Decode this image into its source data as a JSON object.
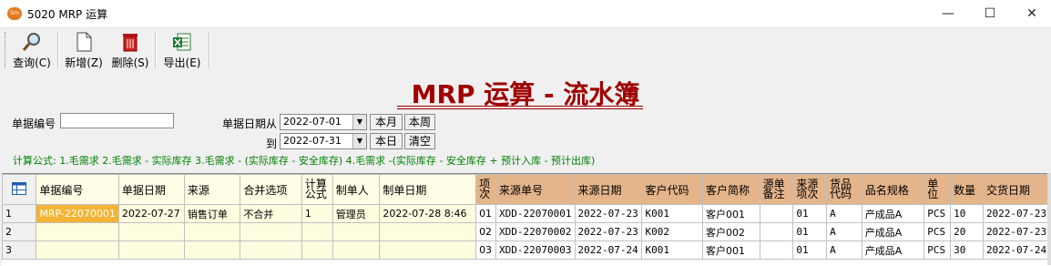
{
  "window": {
    "title": "5020 MRP 运算",
    "app_icon_text": "Sm",
    "minimize": "—",
    "maximize": "☐",
    "close": "✕"
  },
  "toolbar": {
    "query_label": "查询(C)",
    "new_label": "新增(Z)",
    "delete_label": "删除(S)",
    "export_label": "导出(E)"
  },
  "page_title": "MRP 运算 - 流水簿",
  "filters": {
    "doc_no_label": "单据编号",
    "doc_no_value": "",
    "date_from_label": "单据日期从",
    "date_from_value": "2022-07-01",
    "date_to_label": "到",
    "date_to_value": "2022-07-31",
    "this_month": "本月",
    "this_week": "本周",
    "today": "本日",
    "clear": "清空"
  },
  "formula": "计算公式: 1.毛需求  2.毛需求 - 实际库存  3.毛需求 - (实际库存 - 安全库存)  4.毛需求 -(实际库存 - 安全库存 + 预计入库 - 预计出库)",
  "grid": {
    "headers": {
      "doc_no": "单据编号",
      "doc_date": "单据日期",
      "source": "来源",
      "merge": "合并选项",
      "formula_a": "计算",
      "formula_b": "公式",
      "maker": "制单人",
      "make_date": "制单日期",
      "item_a": "项",
      "item_b": "次",
      "src_no": "来源单号",
      "src_date": "来源日期",
      "cust_code": "客户代码",
      "cust_name": "客户简称",
      "src_note_a": "源单",
      "src_note_b": "备注",
      "src_item_a": "来源",
      "src_item_b": "项次",
      "goods_a": "货品",
      "goods_b": "代码",
      "spec": "品名规格",
      "unit_a": "单",
      "unit_b": "位",
      "qty": "数量",
      "deliver": "交货日期"
    },
    "rows": [
      {
        "n": "1",
        "doc_no": "MRP-22070001",
        "doc_date": "2022-07-27",
        "source": "销售订单",
        "merge": "不合并",
        "formula": "1",
        "maker": "管理员",
        "make_date": "2022-07-28 8:46",
        "item": "01",
        "src_no": "XDD-22070001",
        "src_date": "2022-07-23",
        "cust_code": "K001",
        "cust_name": "客户001",
        "src_note": "",
        "src_item": "01",
        "goods": "A",
        "spec": "产成品A",
        "unit": "PCS",
        "qty": "10",
        "deliver": "2022-07-23"
      },
      {
        "n": "2",
        "doc_no": "",
        "doc_date": "",
        "source": "",
        "merge": "",
        "formula": "",
        "maker": "",
        "make_date": "",
        "item": "02",
        "src_no": "XDD-22070002",
        "src_date": "2022-07-23",
        "cust_code": "K002",
        "cust_name": "客户002",
        "src_note": "",
        "src_item": "01",
        "goods": "A",
        "spec": "产成品A",
        "unit": "PCS",
        "qty": "20",
        "deliver": "2022-07-23"
      },
      {
        "n": "3",
        "doc_no": "",
        "doc_date": "",
        "source": "",
        "merge": "",
        "formula": "",
        "maker": "",
        "make_date": "",
        "item": "03",
        "src_no": "XDD-22070003",
        "src_date": "2022-07-24",
        "cust_code": "K001",
        "cust_name": "客户001",
        "src_note": "",
        "src_item": "01",
        "goods": "A",
        "spec": "产成品A",
        "unit": "PCS",
        "qty": "30",
        "deliver": "2022-07-24"
      }
    ]
  }
}
